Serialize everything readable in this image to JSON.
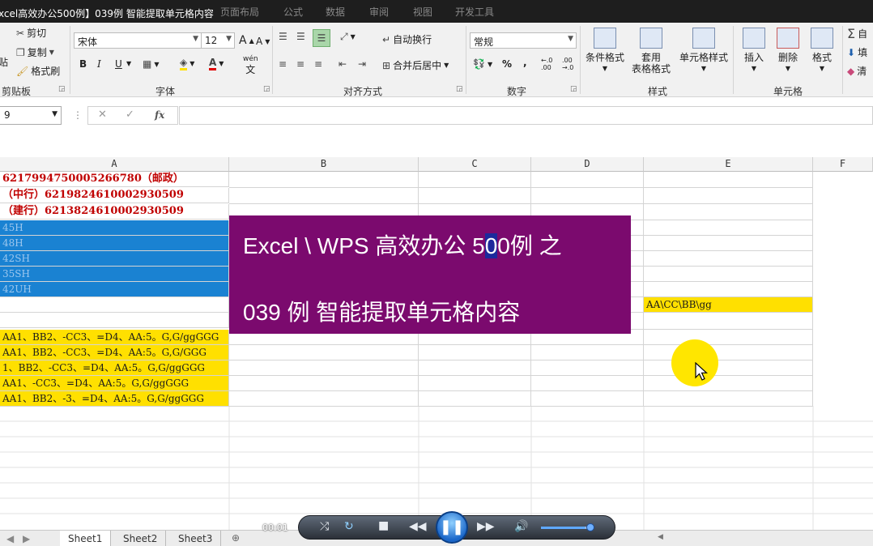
{
  "window": {
    "title": "xcel高效办公500例】039例 智能提取单元格内容",
    "tabs": [
      "页面布局",
      "公式",
      "数据",
      "审阅",
      "视图",
      "开发工具"
    ]
  },
  "ribbon": {
    "clipboard": {
      "cut": "剪切",
      "copy": "复制",
      "format_painter": "格式刷",
      "label": "剪贴板",
      "paste": "贴"
    },
    "font": {
      "name": "宋体",
      "size": "12",
      "label": "字体",
      "bold": "B",
      "italic": "I",
      "underline": "U",
      "grow": "A",
      "shrink": "A",
      "wen": "wén"
    },
    "alignment": {
      "wrap": "自动换行",
      "merge": "合并后居中",
      "label": "对齐方式"
    },
    "number": {
      "format": "常规",
      "percent": "%",
      "comma": ",",
      "label": "数字",
      "inc_decimal": "←.0 .00",
      "dec_decimal": ".00 →.0"
    },
    "styles": {
      "conditional": "条件格式",
      "table_format_1": "套用",
      "table_format_2": "表格格式",
      "cell_styles": "单元格样式",
      "label": "样式"
    },
    "cells": {
      "insert": "插入",
      "delete": "删除",
      "format": "格式",
      "label": "单元格"
    },
    "editing": {
      "autosum": "自",
      "fill": "填",
      "clear": "清"
    }
  },
  "formula_bar": {
    "name_box": "9",
    "cancel": "✕",
    "enter": "✓",
    "fx": "fx",
    "content": ""
  },
  "columns": [
    "A",
    "B",
    "C",
    "D",
    "E",
    "F"
  ],
  "cells": {
    "a1": "6217994750005266780（邮政）",
    "a2": "（中行）6219824610002930509",
    "a3": "（建行）6213824610002930509",
    "a4": "45H",
    "a5": "48H",
    "a6": "42SH",
    "a7": "35SH",
    "a8": "42UH",
    "a11": "AA1、BB2、-CC3、=D4、AA:5。G,G/ggGGG",
    "a12": "AA1、BB2、-CC3、=D4、AA:5。G,G/GGG",
    "a13": "1、BB2、-CC3、=D4、AA:5。G,G/ggGGG",
    "a14": "AA1、-CC3、=D4、AA:5。G,G/ggGGG",
    "a15": "AA1、BB2、-3、=D4、AA:5。G,G/ggGGG",
    "e9": "AA\\CC\\BB\\gg"
  },
  "overlay": {
    "line1_pre": "Excel \\ WPS 高效办公 5",
    "line1_hl": "0",
    "line1_post": "0例 之",
    "line2": "039 例  智能提取单元格内容"
  },
  "sheets": [
    "Sheet1",
    "Sheet2",
    "Sheet3"
  ],
  "player": {
    "time": "00:01",
    "volume_level": 0.85
  },
  "colors": {
    "overlay_bg": "#7b0a6e",
    "blue_fill": "#1a82d2",
    "yellow_fill": "#ffe000",
    "red_text": "#c00000"
  }
}
